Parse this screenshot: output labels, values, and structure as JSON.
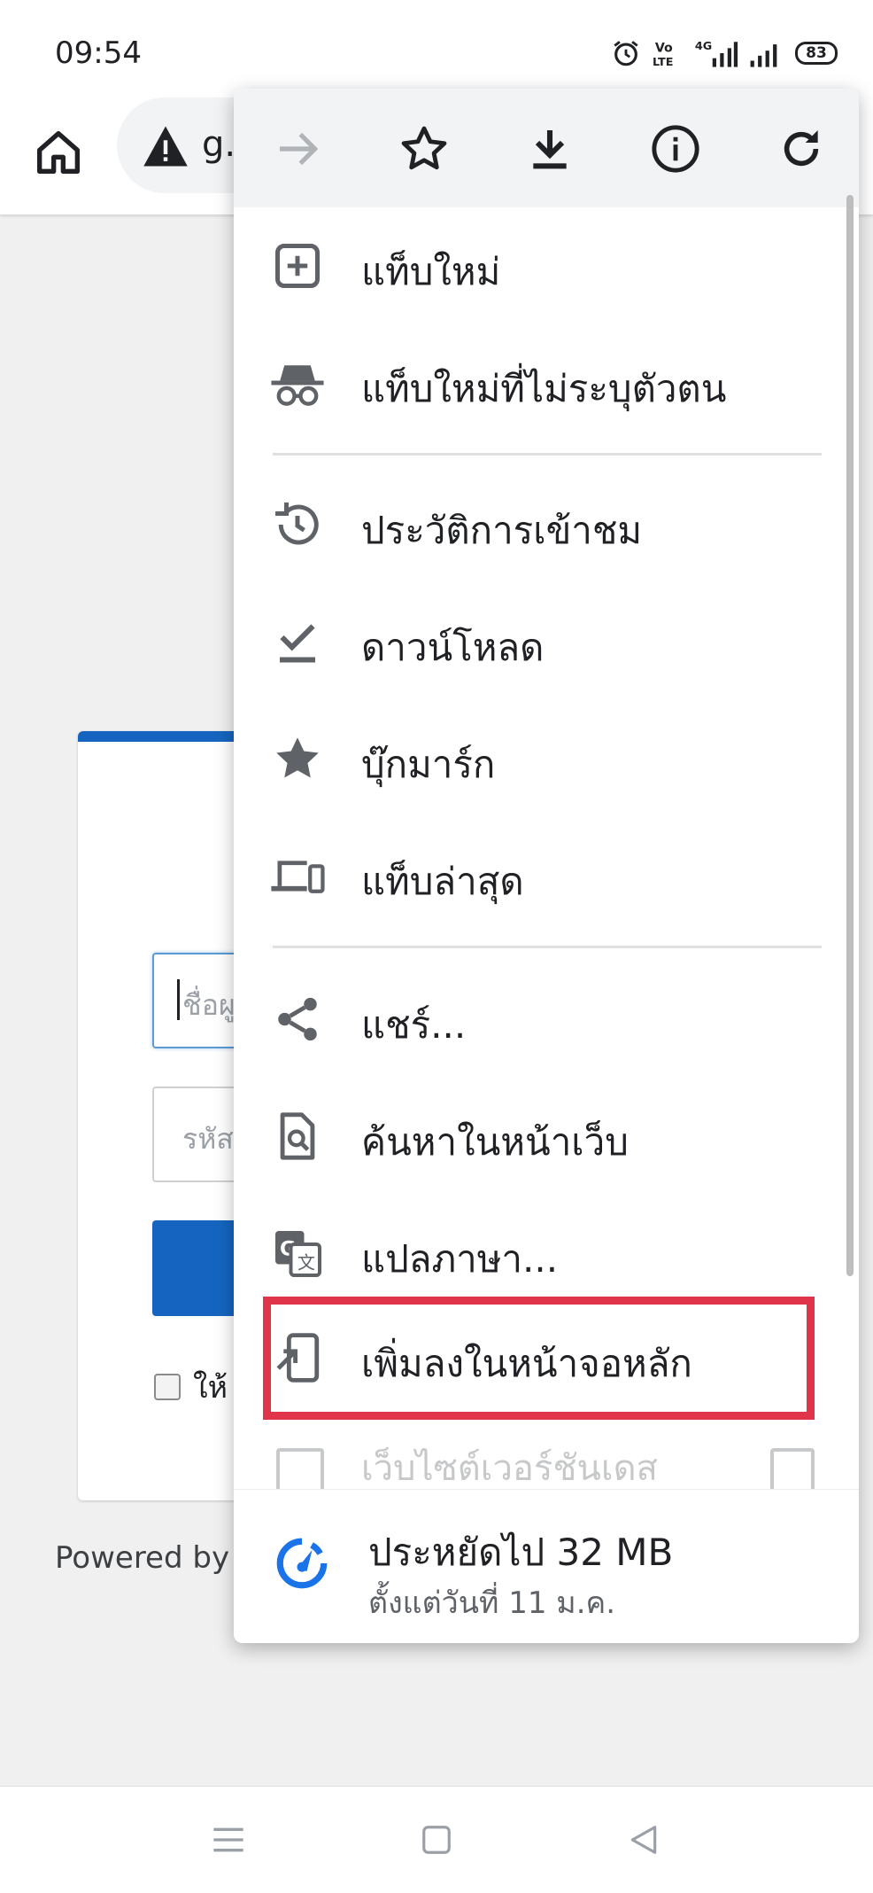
{
  "status_bar": {
    "time": "09:54",
    "battery": "83",
    "icons": [
      "alarm-icon",
      "volte-icon",
      "4g-signal-icon",
      "signal-icon"
    ]
  },
  "toolbar": {
    "url_text": "g.",
    "icons": [
      "home-icon",
      "warning-icon"
    ]
  },
  "page": {
    "username_placeholder": "ชื่อผู",
    "password_placeholder": "รหัส",
    "remember_text": "ให้",
    "powered_by": "Powered by F",
    "accent_color": "#1565c0"
  },
  "menu": {
    "top_icons": [
      "forward-icon",
      "bookmark-star-icon",
      "download-icon",
      "info-icon",
      "refresh-icon"
    ],
    "items": [
      {
        "label": "แท็บใหม่",
        "icon": "new-tab-icon"
      },
      {
        "label": "แท็บใหม่ที่ไม่ระบุตัวตน",
        "icon": "incognito-icon"
      },
      {
        "label": "ประวัติการเข้าชม",
        "icon": "history-icon"
      },
      {
        "label": "ดาวน์โหลด",
        "icon": "downloads-icon"
      },
      {
        "label": "บุ๊กมาร์ก",
        "icon": "bookmarks-icon"
      },
      {
        "label": "แท็บล่าสุด",
        "icon": "recent-tabs-icon"
      },
      {
        "label": "แชร์...",
        "icon": "share-icon"
      },
      {
        "label": "ค้นหาในหน้าเว็บ",
        "icon": "find-in-page-icon"
      },
      {
        "label": "แปลภาษา...",
        "icon": "translate-icon"
      },
      {
        "label": "เพิ่มลงในหน้าจอหลัก",
        "icon": "add-to-home-icon"
      }
    ],
    "faded_item": "เว็บไซต์เวอร์ชันเดส",
    "highlight_color": "#e0344a",
    "savings": {
      "title": "ประหยัดไป 32 MB",
      "subtitle": "ตั้งแต่วันที่ 11 ม.ค.",
      "icon": "data-saver-icon"
    }
  },
  "nav": {
    "icons": [
      "menu-lines-icon",
      "home-square-icon",
      "back-triangle-icon"
    ]
  }
}
